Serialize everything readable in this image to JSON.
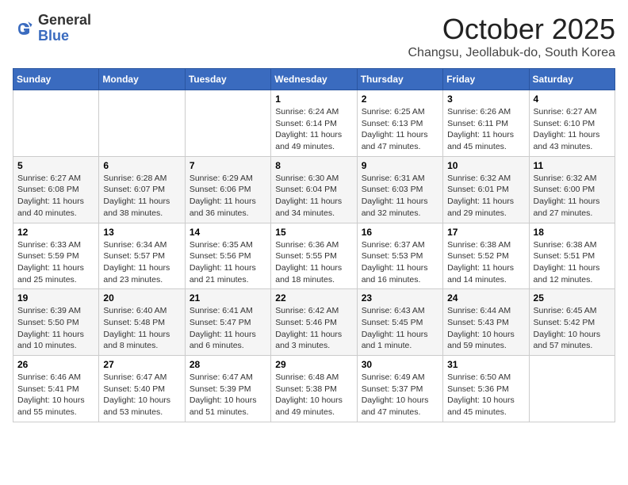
{
  "header": {
    "logo_general": "General",
    "logo_blue": "Blue",
    "month_title": "October 2025",
    "location": "Changsu, Jeollabuk-do, South Korea"
  },
  "days_of_week": [
    "Sunday",
    "Monday",
    "Tuesday",
    "Wednesday",
    "Thursday",
    "Friday",
    "Saturday"
  ],
  "weeks": [
    [
      {
        "day": "",
        "info": ""
      },
      {
        "day": "",
        "info": ""
      },
      {
        "day": "",
        "info": ""
      },
      {
        "day": "1",
        "info": "Sunrise: 6:24 AM\nSunset: 6:14 PM\nDaylight: 11 hours\nand 49 minutes."
      },
      {
        "day": "2",
        "info": "Sunrise: 6:25 AM\nSunset: 6:13 PM\nDaylight: 11 hours\nand 47 minutes."
      },
      {
        "day": "3",
        "info": "Sunrise: 6:26 AM\nSunset: 6:11 PM\nDaylight: 11 hours\nand 45 minutes."
      },
      {
        "day": "4",
        "info": "Sunrise: 6:27 AM\nSunset: 6:10 PM\nDaylight: 11 hours\nand 43 minutes."
      }
    ],
    [
      {
        "day": "5",
        "info": "Sunrise: 6:27 AM\nSunset: 6:08 PM\nDaylight: 11 hours\nand 40 minutes."
      },
      {
        "day": "6",
        "info": "Sunrise: 6:28 AM\nSunset: 6:07 PM\nDaylight: 11 hours\nand 38 minutes."
      },
      {
        "day": "7",
        "info": "Sunrise: 6:29 AM\nSunset: 6:06 PM\nDaylight: 11 hours\nand 36 minutes."
      },
      {
        "day": "8",
        "info": "Sunrise: 6:30 AM\nSunset: 6:04 PM\nDaylight: 11 hours\nand 34 minutes."
      },
      {
        "day": "9",
        "info": "Sunrise: 6:31 AM\nSunset: 6:03 PM\nDaylight: 11 hours\nand 32 minutes."
      },
      {
        "day": "10",
        "info": "Sunrise: 6:32 AM\nSunset: 6:01 PM\nDaylight: 11 hours\nand 29 minutes."
      },
      {
        "day": "11",
        "info": "Sunrise: 6:32 AM\nSunset: 6:00 PM\nDaylight: 11 hours\nand 27 minutes."
      }
    ],
    [
      {
        "day": "12",
        "info": "Sunrise: 6:33 AM\nSunset: 5:59 PM\nDaylight: 11 hours\nand 25 minutes."
      },
      {
        "day": "13",
        "info": "Sunrise: 6:34 AM\nSunset: 5:57 PM\nDaylight: 11 hours\nand 23 minutes."
      },
      {
        "day": "14",
        "info": "Sunrise: 6:35 AM\nSunset: 5:56 PM\nDaylight: 11 hours\nand 21 minutes."
      },
      {
        "day": "15",
        "info": "Sunrise: 6:36 AM\nSunset: 5:55 PM\nDaylight: 11 hours\nand 18 minutes."
      },
      {
        "day": "16",
        "info": "Sunrise: 6:37 AM\nSunset: 5:53 PM\nDaylight: 11 hours\nand 16 minutes."
      },
      {
        "day": "17",
        "info": "Sunrise: 6:38 AM\nSunset: 5:52 PM\nDaylight: 11 hours\nand 14 minutes."
      },
      {
        "day": "18",
        "info": "Sunrise: 6:38 AM\nSunset: 5:51 PM\nDaylight: 11 hours\nand 12 minutes."
      }
    ],
    [
      {
        "day": "19",
        "info": "Sunrise: 6:39 AM\nSunset: 5:50 PM\nDaylight: 11 hours\nand 10 minutes."
      },
      {
        "day": "20",
        "info": "Sunrise: 6:40 AM\nSunset: 5:48 PM\nDaylight: 11 hours\nand 8 minutes."
      },
      {
        "day": "21",
        "info": "Sunrise: 6:41 AM\nSunset: 5:47 PM\nDaylight: 11 hours\nand 6 minutes."
      },
      {
        "day": "22",
        "info": "Sunrise: 6:42 AM\nSunset: 5:46 PM\nDaylight: 11 hours\nand 3 minutes."
      },
      {
        "day": "23",
        "info": "Sunrise: 6:43 AM\nSunset: 5:45 PM\nDaylight: 11 hours\nand 1 minute."
      },
      {
        "day": "24",
        "info": "Sunrise: 6:44 AM\nSunset: 5:43 PM\nDaylight: 10 hours\nand 59 minutes."
      },
      {
        "day": "25",
        "info": "Sunrise: 6:45 AM\nSunset: 5:42 PM\nDaylight: 10 hours\nand 57 minutes."
      }
    ],
    [
      {
        "day": "26",
        "info": "Sunrise: 6:46 AM\nSunset: 5:41 PM\nDaylight: 10 hours\nand 55 minutes."
      },
      {
        "day": "27",
        "info": "Sunrise: 6:47 AM\nSunset: 5:40 PM\nDaylight: 10 hours\nand 53 minutes."
      },
      {
        "day": "28",
        "info": "Sunrise: 6:47 AM\nSunset: 5:39 PM\nDaylight: 10 hours\nand 51 minutes."
      },
      {
        "day": "29",
        "info": "Sunrise: 6:48 AM\nSunset: 5:38 PM\nDaylight: 10 hours\nand 49 minutes."
      },
      {
        "day": "30",
        "info": "Sunrise: 6:49 AM\nSunset: 5:37 PM\nDaylight: 10 hours\nand 47 minutes."
      },
      {
        "day": "31",
        "info": "Sunrise: 6:50 AM\nSunset: 5:36 PM\nDaylight: 10 hours\nand 45 minutes."
      },
      {
        "day": "",
        "info": ""
      }
    ]
  ]
}
